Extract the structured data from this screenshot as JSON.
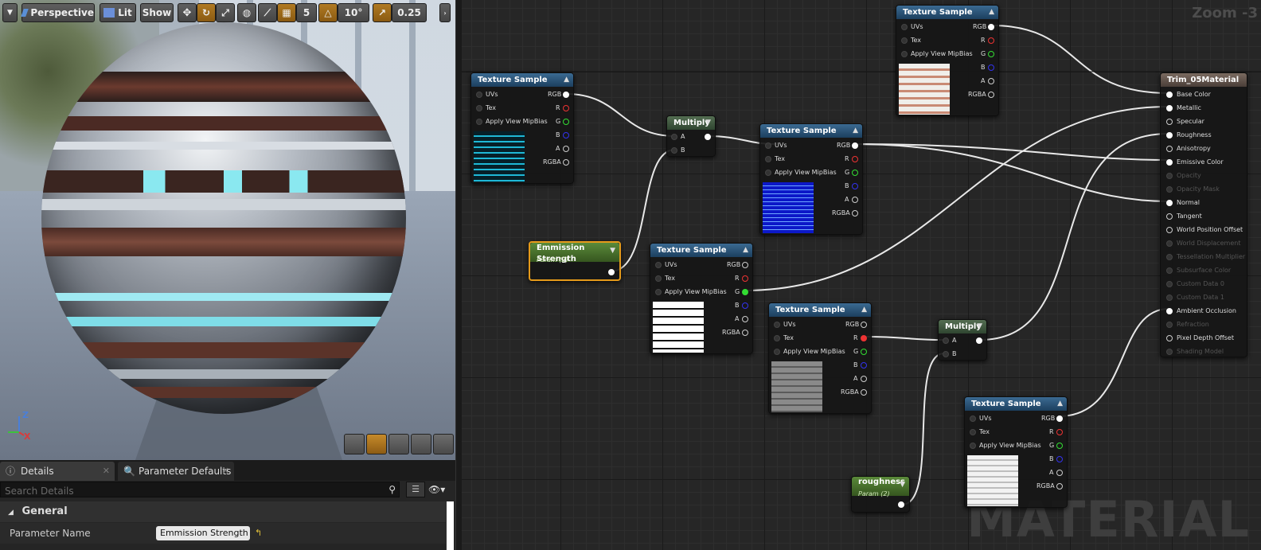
{
  "toolbar": {
    "perspective": "Perspective",
    "lit": "Lit",
    "show": "Show",
    "grid_value": "5",
    "rotation_value": "10°",
    "scale_value": "0.25"
  },
  "viewport": {
    "axis_z": "Z",
    "axis_x": "X"
  },
  "details": {
    "tabs": [
      {
        "label": "Details"
      },
      {
        "label": "Parameter Defaults"
      }
    ],
    "search_placeholder": "Search Details",
    "section": "General",
    "property_name": "Parameter Name",
    "property_value": "Emmission Strength"
  },
  "graph": {
    "zoom": "Zoom -3",
    "watermark": "MATERIAL",
    "nodes": {
      "ts1": {
        "title": "Texture Sample",
        "pins_left": [
          "UVs",
          "Tex",
          "Apply View MipBias"
        ],
        "pins_right": [
          "RGB",
          "R",
          "G",
          "B",
          "A",
          "RGBA"
        ]
      },
      "ts2": {
        "title": "Texture Sample",
        "pins_left": [
          "UVs",
          "Tex",
          "Apply View MipBias"
        ],
        "pins_right": [
          "RGB",
          "R",
          "G",
          "B",
          "A",
          "RGBA"
        ]
      },
      "ts3": {
        "title": "Texture Sample",
        "pins_left": [
          "UVs",
          "Tex",
          "Apply View MipBias"
        ],
        "pins_right": [
          "RGB",
          "R",
          "G",
          "B",
          "A",
          "RGBA"
        ]
      },
      "ts4": {
        "title": "Texture Sample",
        "pins_left": [
          "UVs",
          "Tex",
          "Apply View MipBias"
        ],
        "pins_right": [
          "RGB",
          "R",
          "G",
          "B",
          "A",
          "RGBA"
        ]
      },
      "ts5": {
        "title": "Texture Sample",
        "pins_left": [
          "UVs",
          "Tex",
          "Apply View MipBias"
        ],
        "pins_right": [
          "RGB",
          "R",
          "G",
          "B",
          "A",
          "RGBA"
        ]
      },
      "ts6": {
        "title": "Texture Sample",
        "pins_left": [
          "UVs",
          "Tex",
          "Apply View MipBias"
        ],
        "pins_right": [
          "RGB",
          "R",
          "G",
          "B",
          "A",
          "RGBA"
        ]
      },
      "mul1": {
        "title": "Multiply",
        "pins": [
          "A",
          "B"
        ]
      },
      "mul2": {
        "title": "Multiply",
        "pins": [
          "A",
          "B"
        ]
      },
      "emission": {
        "title": "Emmission Strength",
        "sub": "Param (2)"
      },
      "roughness": {
        "title": "roughness",
        "sub": "Param (2)"
      },
      "result": {
        "title": "Trim_05Material",
        "pins": [
          "Base Color",
          "Metallic",
          "Specular",
          "Roughness",
          "Anisotropy",
          "Emissive Color",
          "Opacity",
          "Opacity Mask",
          "Normal",
          "Tangent",
          "World Position Offset",
          "World Displacement",
          "Tessellation Multiplier",
          "Subsurface Color",
          "Custom Data 0",
          "Custom Data 1",
          "Ambient Occlusion",
          "Refraction",
          "Pixel Depth Offset",
          "Shading Model"
        ]
      }
    }
  },
  "colors": {
    "accent_orange": "#e59a1a",
    "texture_header": "#2b5478",
    "multiply_header": "#3f5a3e",
    "param_header": "#4e7a31",
    "result_header": "#64554b"
  }
}
